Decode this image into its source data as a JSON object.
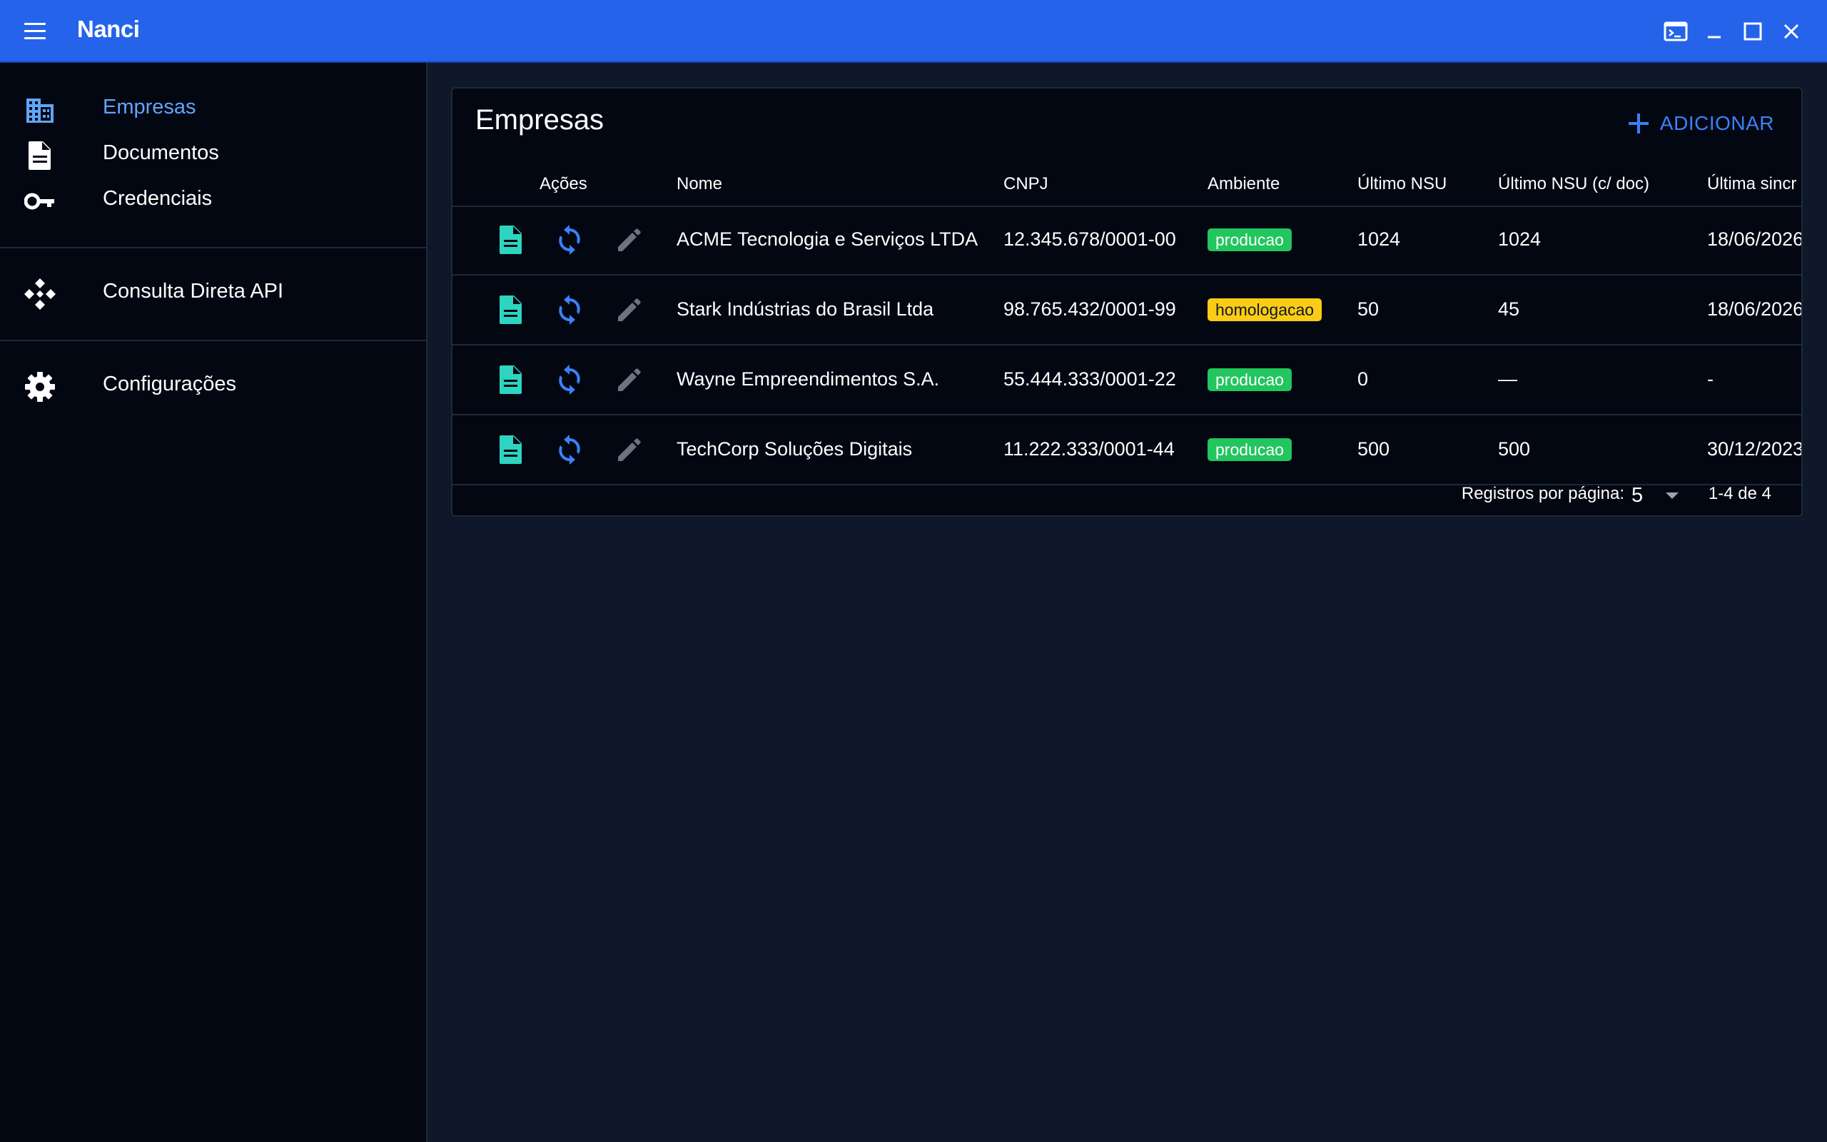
{
  "app": {
    "title": "Nanci"
  },
  "sidebar": {
    "items": [
      {
        "label": "Empresas",
        "icon": "building-icon",
        "active": true
      },
      {
        "label": "Documentos",
        "icon": "document-icon"
      },
      {
        "label": "Credenciais",
        "icon": "key-icon"
      },
      {
        "label": "Consulta Direta API",
        "icon": "api-icon"
      },
      {
        "label": "Configurações",
        "icon": "gear-icon"
      }
    ]
  },
  "main": {
    "title": "Empresas",
    "add_label": "ADICIONAR",
    "columns": [
      "Ações",
      "Nome",
      "CNPJ",
      "Ambiente",
      "Último NSU",
      "Último NSU (c/ doc)",
      "Última sincr"
    ],
    "rows": [
      {
        "nome": "ACME Tecnologia e Serviços LTDA",
        "cnpj": "12.345.678/0001-00",
        "ambiente": "producao",
        "ultimo_nsu": "1024",
        "ultimo_nsu_doc": "1024",
        "ultima_sinc": "18/06/2026"
      },
      {
        "nome": "Stark Indústrias do Brasil Ltda",
        "cnpj": "98.765.432/0001-99",
        "ambiente": "homologacao",
        "ultimo_nsu": "50",
        "ultimo_nsu_doc": "45",
        "ultima_sinc": "18/06/2026"
      },
      {
        "nome": "Wayne Empreendimentos S.A.",
        "cnpj": "55.444.333/0001-22",
        "ambiente": "producao",
        "ultimo_nsu": "0",
        "ultimo_nsu_doc": "—",
        "ultima_sinc": "-"
      },
      {
        "nome": "TechCorp Soluções Digitais",
        "cnpj": "11.222.333/0001-44",
        "ambiente": "producao",
        "ultimo_nsu": "500",
        "ultimo_nsu_doc": "500",
        "ultima_sinc": "30/12/2023"
      }
    ],
    "pagination": {
      "rows_per_page_label": "Registros por página:",
      "rows_per_page": "5",
      "range": "1-4 de 4"
    }
  },
  "colors": {
    "appbar": "#2563eb",
    "accent": "#60a5fa",
    "action_doc": "#2dd4bf",
    "action_sync": "#3b82f6",
    "action_edit": "#6b7280",
    "badge_producao": "#22c55e",
    "badge_homologacao": "#facc15"
  }
}
